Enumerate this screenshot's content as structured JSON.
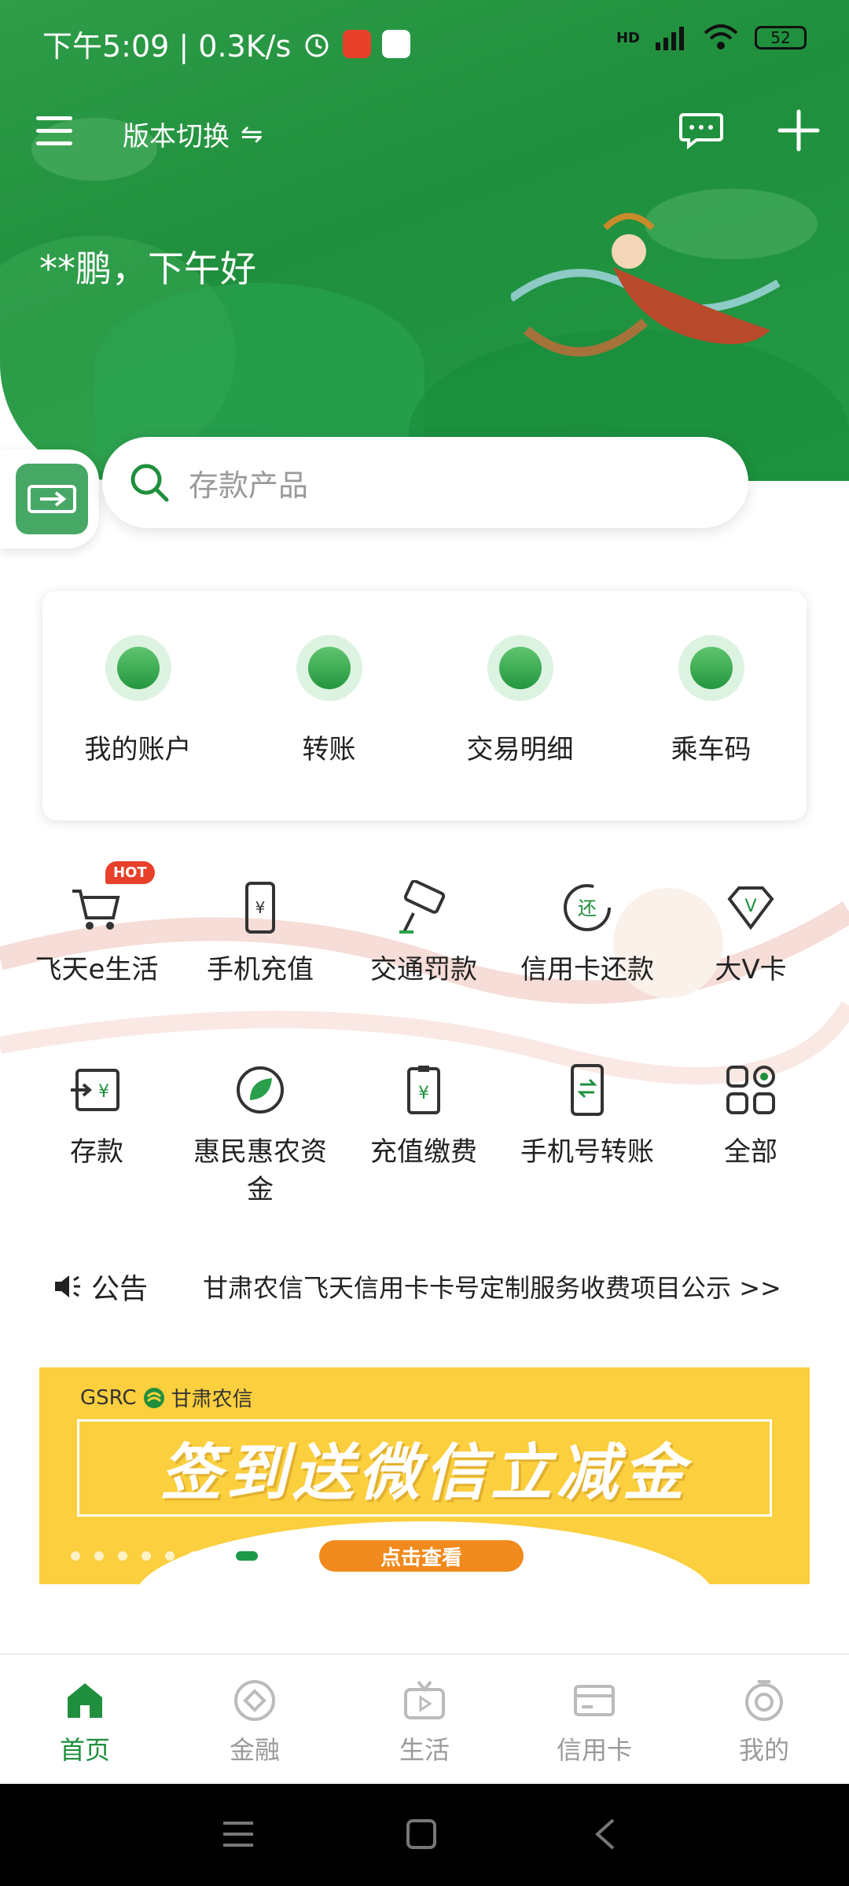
{
  "status_bar": {
    "time_speed": "下午5:09 | 0.3K/s",
    "network": "HD",
    "battery": "52"
  },
  "header": {
    "version_label": "版本切换",
    "version_arrow": "⇋",
    "greeting": "**鹏，下午好"
  },
  "search": {
    "placeholder": "存款产品"
  },
  "quick_actions": [
    {
      "label": "我的账户",
      "icon": "account-icon"
    },
    {
      "label": "转账",
      "icon": "transfer-icon"
    },
    {
      "label": "交易明细",
      "icon": "details-icon"
    },
    {
      "label": "乘车码",
      "icon": "bus-code-icon"
    }
  ],
  "services_row1": [
    {
      "label": "飞天e生活",
      "icon": "cart-icon",
      "badge": "HOT"
    },
    {
      "label": "手机充值",
      "icon": "phone-topup-icon"
    },
    {
      "label": "交通罚款",
      "icon": "camera-icon"
    },
    {
      "label": "信用卡还款",
      "icon": "repay-icon",
      "icon_text": "还"
    },
    {
      "label": "大V卡",
      "icon": "diamond-v-icon",
      "icon_text": "V"
    }
  ],
  "services_row2": [
    {
      "label": "存款",
      "icon": "deposit-icon",
      "icon_text": "¥"
    },
    {
      "label": "惠民惠农资金",
      "label_line1": "惠民惠农资",
      "label_line2": "金",
      "icon": "leaf-icon"
    },
    {
      "label": "充值缴费",
      "icon": "recharge-icon",
      "icon_text": "¥"
    },
    {
      "label": "手机号转账",
      "icon": "phone-transfer-icon"
    },
    {
      "label": "全部",
      "icon": "all-icon"
    }
  ],
  "notice": {
    "title": "公告",
    "text": "甘肃农信飞天信用卡卡号定制服务收费项目公示 >>"
  },
  "banner": {
    "brand": "GSRC",
    "brand_cn": "甘肃农信",
    "headline": "签到送微信立减金",
    "cta": "点击查看"
  },
  "bottom_nav": [
    {
      "label": "首页",
      "icon": "home-icon",
      "active": true
    },
    {
      "label": "金融",
      "icon": "finance-icon"
    },
    {
      "label": "生活",
      "icon": "life-icon"
    },
    {
      "label": "信用卡",
      "icon": "credit-card-icon"
    },
    {
      "label": "我的",
      "icon": "profile-icon"
    }
  ],
  "colors": {
    "brand_green": "#1f8f3d",
    "banner_yellow": "#fbcf3e",
    "hot_red": "#e8402a"
  }
}
